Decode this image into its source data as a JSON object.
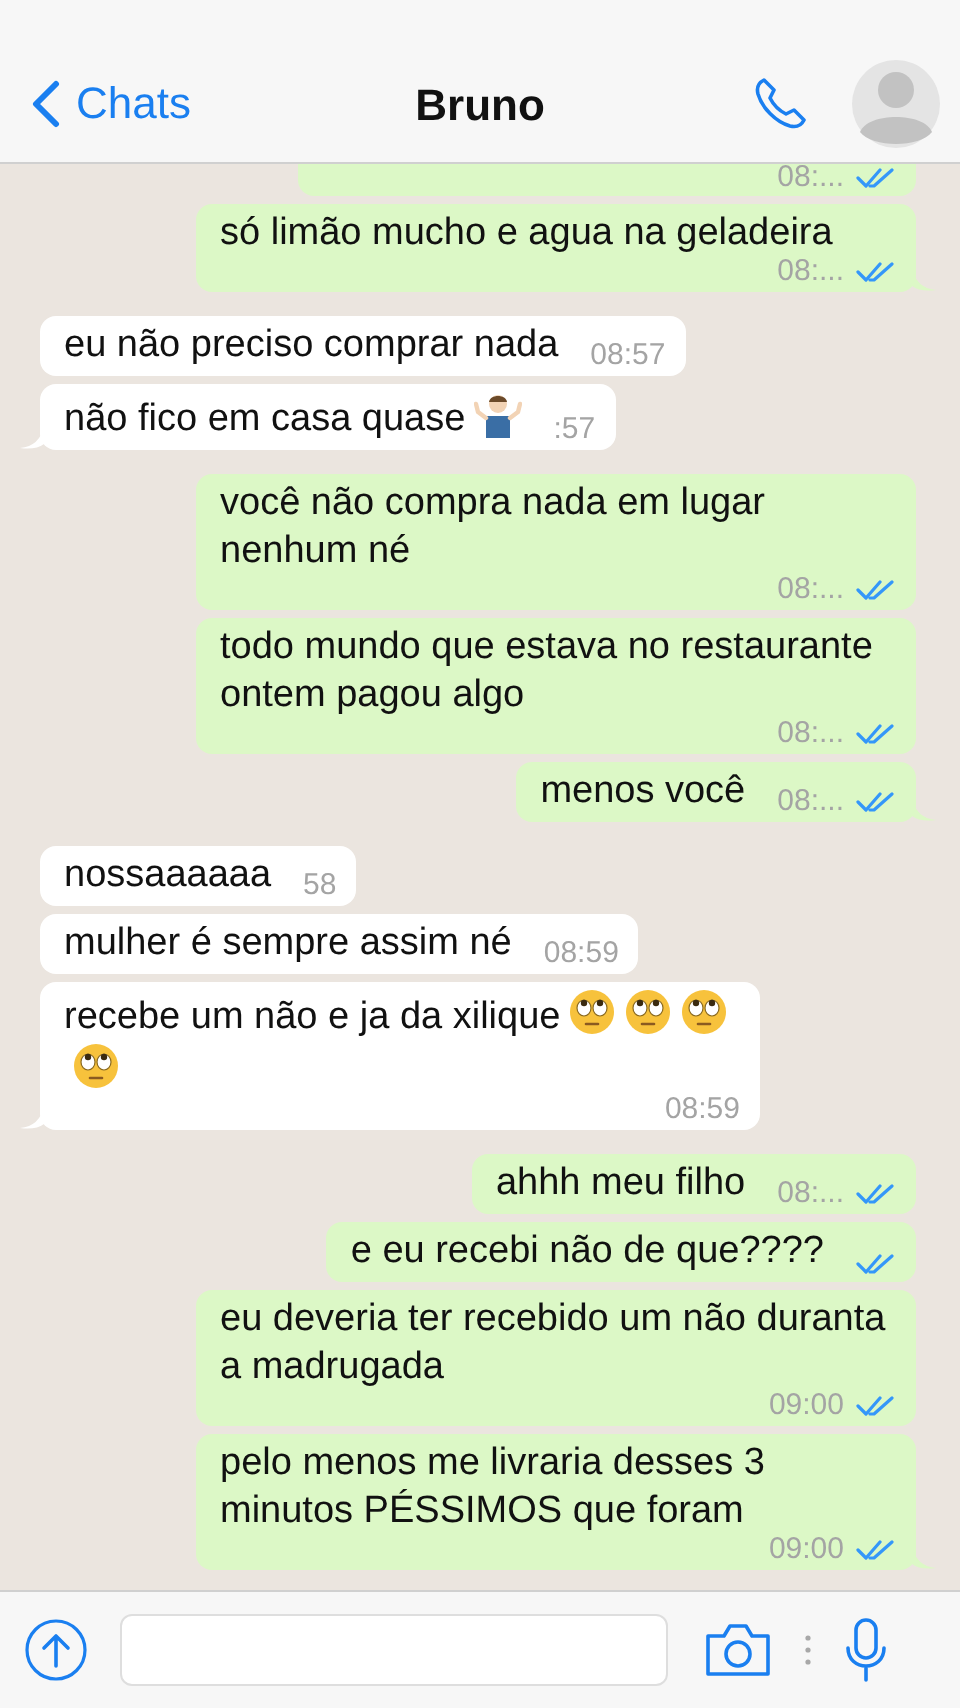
{
  "header": {
    "back_label": "Chats",
    "title": "Bruno"
  },
  "messages": [
    {
      "outgoing": true,
      "time": "08:...",
      "read": true,
      "tail": false
    },
    {
      "outgoing": true,
      "text": "só limão mucho e agua na geladeira",
      "time": "08:...",
      "read": true,
      "tail": true
    },
    {
      "outgoing": false,
      "text": "eu não preciso comprar nada",
      "time": "08:57",
      "tail": false
    },
    {
      "outgoing": false,
      "text": "não fico em casa quase",
      "emojis": [
        {
          "kind": "shrug"
        }
      ],
      "time": ":57",
      "tail": true
    },
    {
      "outgoing": true,
      "text": "você não compra nada em lugar nenhum né",
      "time": "08:...",
      "read": true,
      "tail": false
    },
    {
      "outgoing": true,
      "text": "todo mundo que estava no restaurante ontem pagou algo",
      "time": "08:...",
      "read": true,
      "tail": false
    },
    {
      "outgoing": true,
      "text": "menos você",
      "time": "08:...",
      "read": true,
      "tail": true
    },
    {
      "outgoing": false,
      "text": "nossaaaaaa",
      "time": "58",
      "tail": false
    },
    {
      "outgoing": false,
      "text": "mulher é sempre assim né",
      "time": "08:59",
      "tail": false
    },
    {
      "outgoing": false,
      "text": "recebe um não e ja da xilique",
      "emojis": [
        {
          "kind": "eyeroll"
        },
        {
          "kind": "eyeroll"
        },
        {
          "kind": "eyeroll"
        },
        {
          "kind": "eyeroll"
        }
      ],
      "time": "08:59",
      "tail": true
    },
    {
      "outgoing": true,
      "text": "ahhh meu filho",
      "time": "08:...",
      "read": true,
      "tail": false
    },
    {
      "outgoing": true,
      "text": "e eu recebi não de que????",
      "read": true,
      "tail": false
    },
    {
      "outgoing": true,
      "text": "eu deveria ter recebido um não duranta a madrugada",
      "time": "09:00",
      "read": true,
      "tail": false
    },
    {
      "outgoing": true,
      "text": "pelo menos me livraria desses 3 minutos PÉSSIMOS que foram",
      "time": "09:00",
      "read": true,
      "tail": true
    }
  ]
}
